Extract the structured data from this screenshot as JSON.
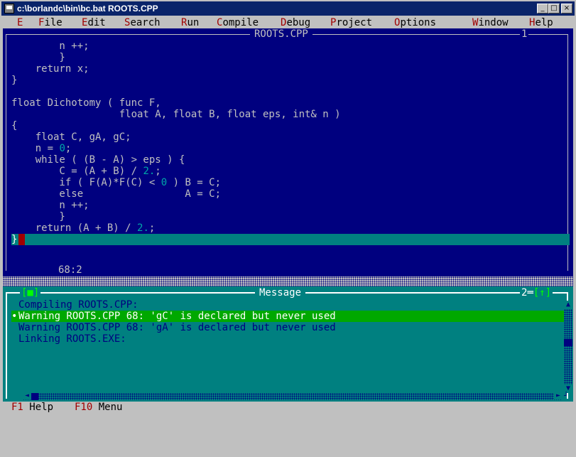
{
  "window": {
    "title": "c:\\borlandc\\bin\\bc.bat ROOTS.CPP",
    "minimize": "_",
    "maximize": "□",
    "close": "×"
  },
  "menu": [
    {
      "hot": "E",
      "rest": ""
    },
    {
      "hot": "F",
      "rest": "ile"
    },
    {
      "hot": "E",
      "rest": "dit"
    },
    {
      "hot": "S",
      "rest": "earch"
    },
    {
      "hot": "R",
      "rest": "un"
    },
    {
      "hot": "C",
      "rest": "ompile"
    },
    {
      "hot": "D",
      "rest": "ebug"
    },
    {
      "hot": "P",
      "rest": "roject"
    },
    {
      "hot": "O",
      "rest": "ptions"
    },
    {
      "hot": "W",
      "rest": "indow"
    },
    {
      "hot": "H",
      "rest": "elp"
    }
  ],
  "editor": {
    "title": "ROOTS.CPP",
    "window_number": "1",
    "position": "68:2",
    "code_lines": [
      [
        {
          "t": "        n ++;"
        }
      ],
      [
        {
          "t": "        }"
        }
      ],
      [
        {
          "t": "    return x;"
        }
      ],
      [
        {
          "t": "}"
        }
      ],
      [
        {
          "t": ""
        }
      ],
      [
        {
          "t": "float Dichotomy ( func F,"
        }
      ],
      [
        {
          "t": "                  float A, float B, float eps, int& n )"
        }
      ],
      [
        {
          "t": "{"
        }
      ],
      [
        {
          "t": "    float C, gA, gC;"
        }
      ],
      [
        {
          "t": "    n = "
        },
        {
          "t": "0",
          "c": "num"
        },
        {
          "t": ";"
        }
      ],
      [
        {
          "t": "    while ( (B - A) > eps ) {"
        }
      ],
      [
        {
          "t": "        C = (A + B) / "
        },
        {
          "t": "2.",
          "c": "num"
        },
        {
          "t": ";"
        }
      ],
      [
        {
          "t": "        if ( F(A)*F(C) < "
        },
        {
          "t": "0",
          "c": "num"
        },
        {
          "t": " ) B = C;"
        }
      ],
      [
        {
          "t": "        else                 A = C;"
        }
      ],
      [
        {
          "t": "        n ++;"
        }
      ],
      [
        {
          "t": "        }"
        }
      ],
      [
        {
          "t": "    return (A + B) / "
        },
        {
          "t": "2.",
          "c": "num"
        },
        {
          "t": ";"
        }
      ]
    ],
    "cursor_line_text": "}"
  },
  "message": {
    "title": "Message",
    "close_box": "[■]",
    "window_number": "2",
    "zoom_box": "[↑]",
    "lines": [
      {
        "bullet": "",
        "text": "Compiling ROOTS.CPP:",
        "selected": false
      },
      {
        "bullet": "•",
        "text": "Warning ROOTS.CPP 68: 'gC' is declared but never used",
        "selected": true
      },
      {
        "bullet": "",
        "text": "Warning ROOTS.CPP 68: 'gA' is declared but never used",
        "selected": false
      },
      {
        "bullet": "",
        "text": "Linking ROOTS.EXE:",
        "selected": false
      }
    ]
  },
  "status": [
    {
      "key": "F1",
      "label": " Help"
    },
    {
      "key": "F10",
      "label": " Menu"
    }
  ],
  "colors": {
    "editor_bg": "#00007f",
    "message_bg": "#008080",
    "selected_bg": "#00a800",
    "hotkey": "#a00000"
  }
}
